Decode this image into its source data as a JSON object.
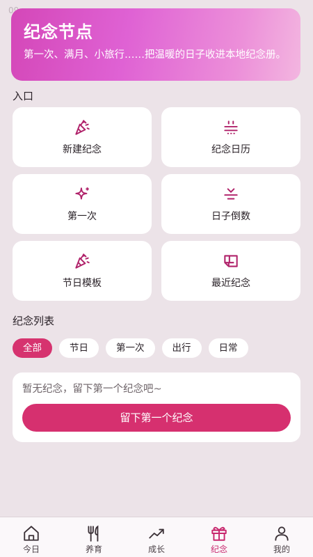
{
  "status": {
    "time": "09"
  },
  "hero": {
    "title": "纪念节点",
    "subtitle": "第一次、满月、小旅行……把温暖的日子收进本地纪念册。"
  },
  "entry_section": {
    "label": "入口",
    "items": [
      {
        "label": "新建纪念",
        "icon": "party-popper-icon"
      },
      {
        "label": "纪念日历",
        "icon": "calendar-icon"
      },
      {
        "label": "第一次",
        "icon": "sparkle-icon"
      },
      {
        "label": "日子倒数",
        "icon": "countdown-icon"
      },
      {
        "label": "节日模板",
        "icon": "party-popper-icon"
      },
      {
        "label": "最近纪念",
        "icon": "recent-icon"
      }
    ]
  },
  "list_section": {
    "label": "纪念列表",
    "filters": [
      "全部",
      "节日",
      "第一次",
      "出行",
      "日常"
    ],
    "active_filter": "全部",
    "empty_text": "暂无纪念，留下第一个纪念吧~",
    "create_button": "留下第一个纪念"
  },
  "bottom_nav": {
    "items": [
      {
        "label": "今日",
        "icon": "home-icon"
      },
      {
        "label": "养育",
        "icon": "utensils-icon"
      },
      {
        "label": "成长",
        "icon": "trend-icon"
      },
      {
        "label": "纪念",
        "icon": "gift-icon"
      },
      {
        "label": "我的",
        "icon": "user-icon"
      }
    ],
    "active": "纪念"
  },
  "colors": {
    "accent": "#d6336f",
    "icon": "#b0226a",
    "background": "#ece3e8"
  }
}
